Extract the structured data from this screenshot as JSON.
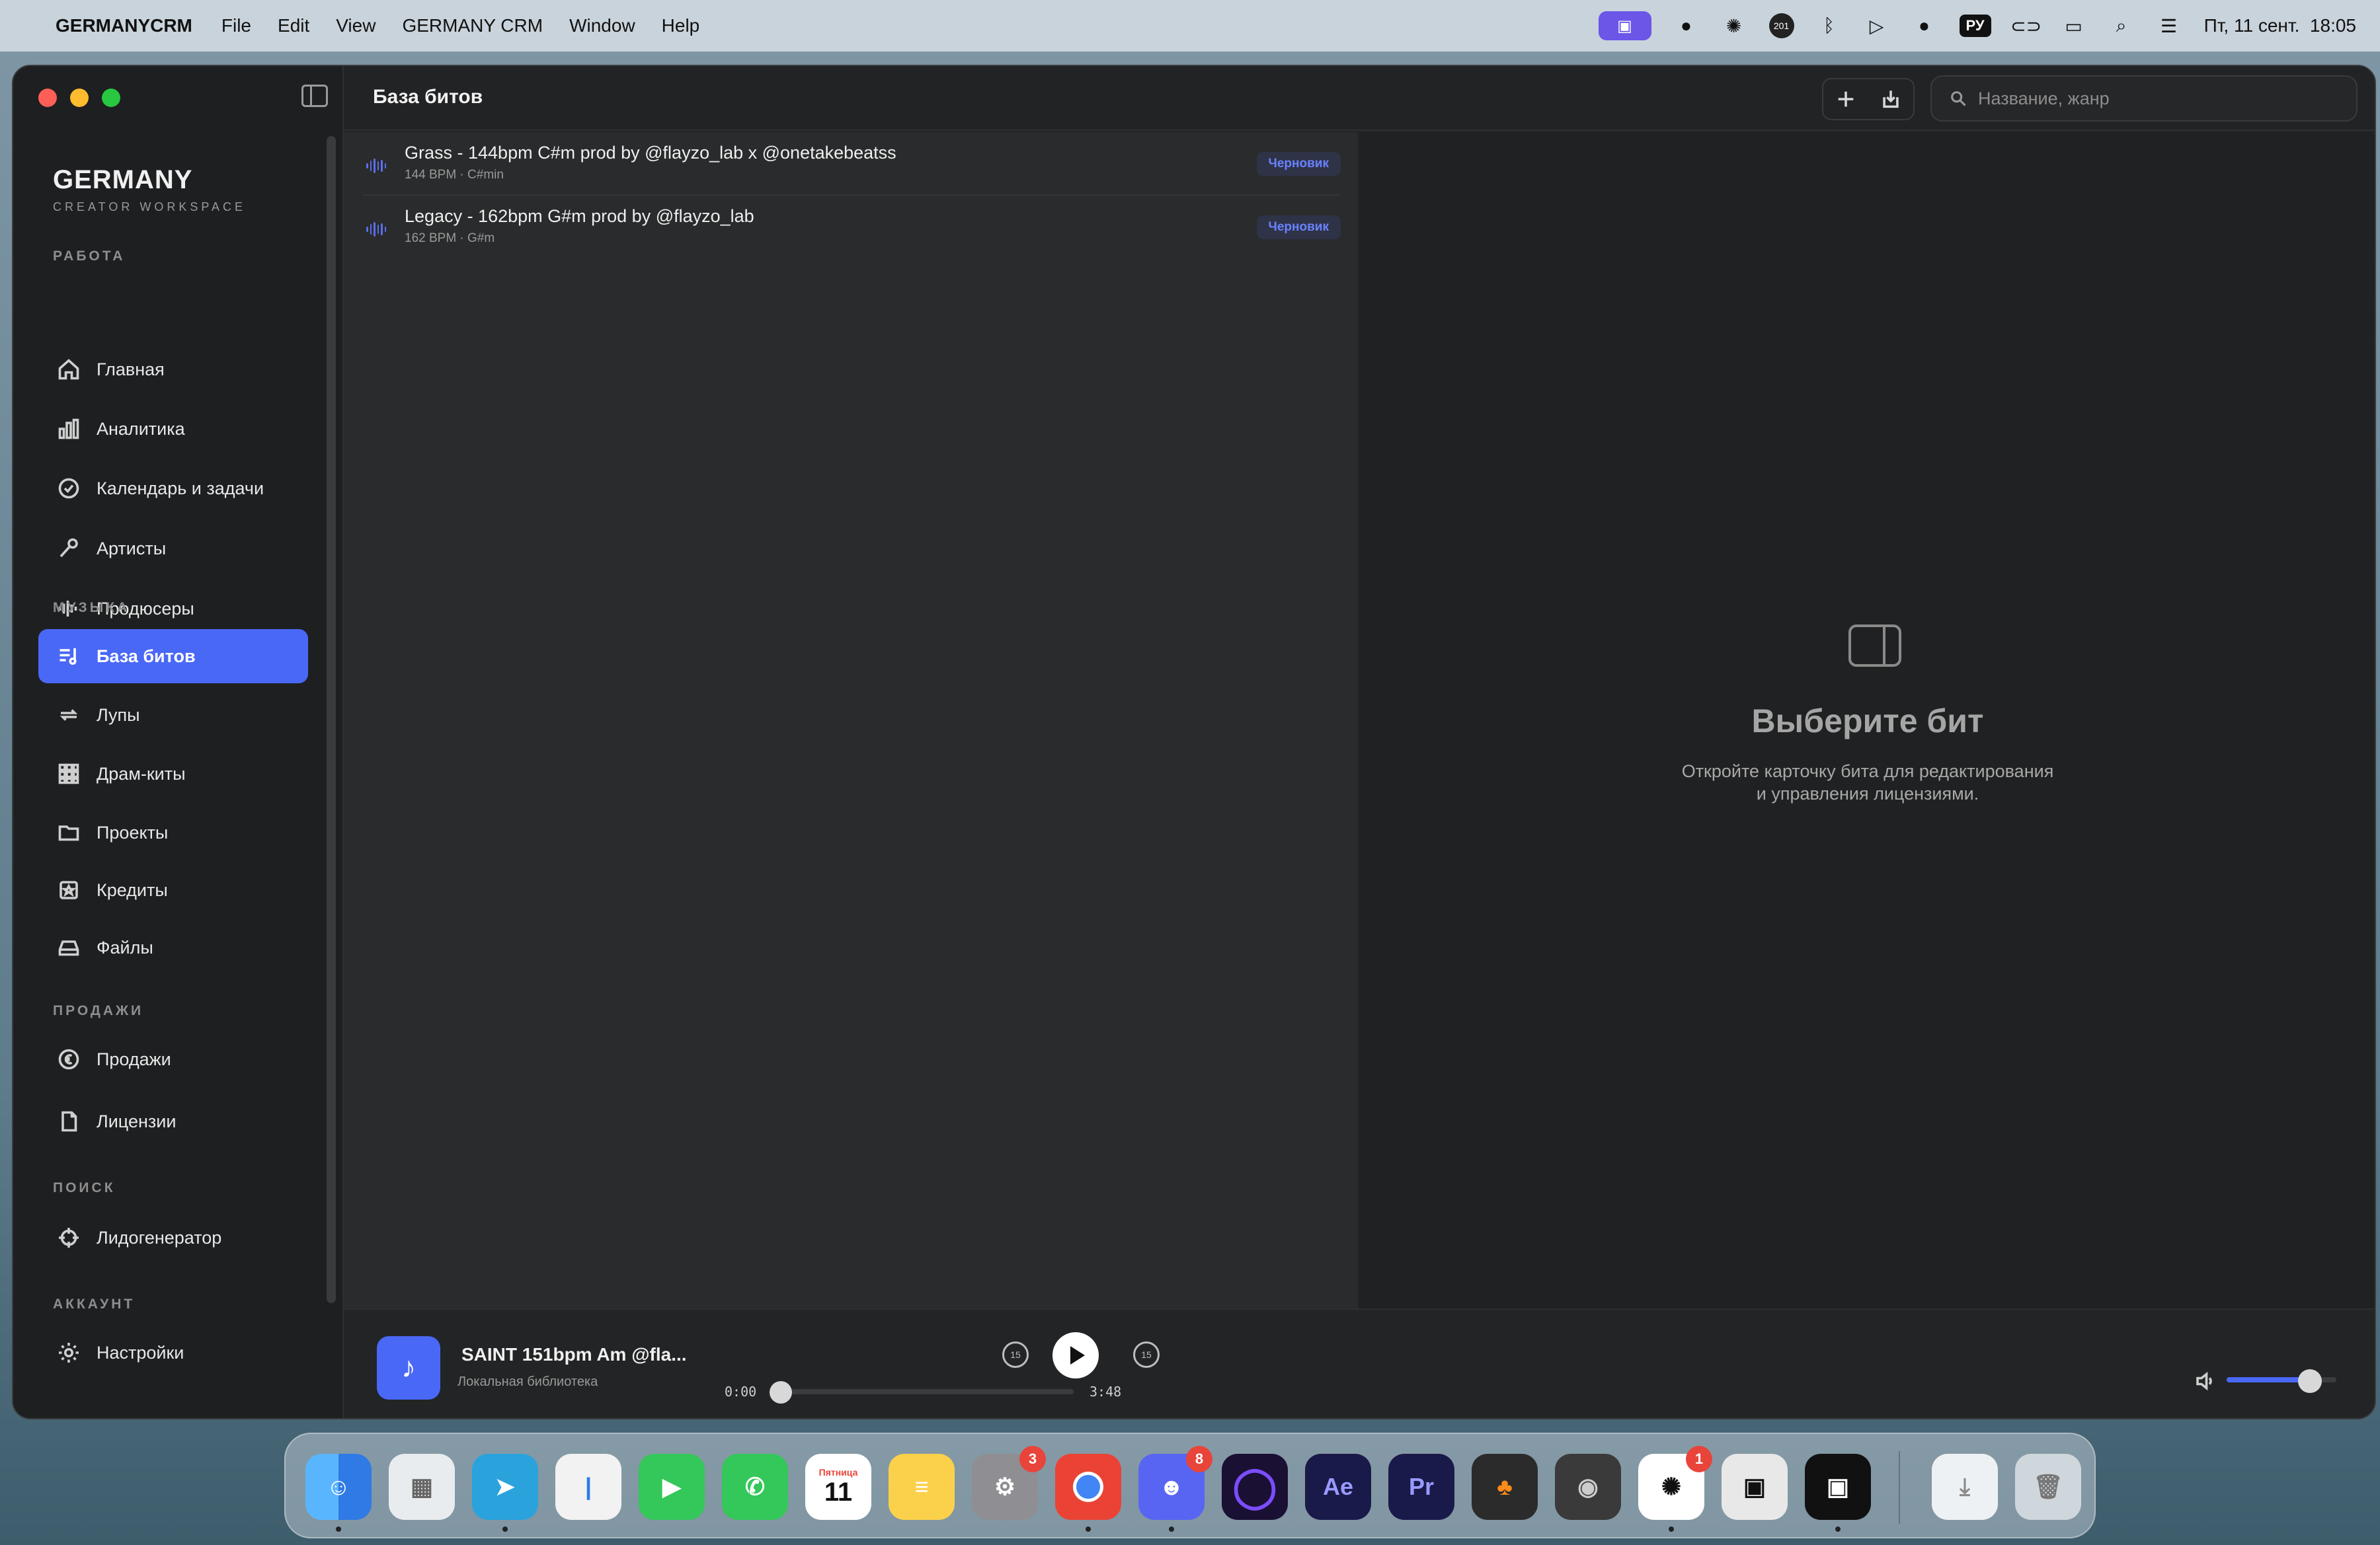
{
  "menubar": {
    "app_name": "GERMANYCRM",
    "menus": [
      "File",
      "Edit",
      "View",
      "GERMANY CRM",
      "Window",
      "Help"
    ],
    "lang": "РУ",
    "datetime": "Пт, 11 сент.  18:05",
    "badge_201": "201"
  },
  "window": {
    "brand": {
      "name": "GERMANY",
      "sub": "CREATOR WORKSPACE"
    },
    "sections": {
      "work": "РАБОТА",
      "music": "МУЗЫКА",
      "sales": "ПРОДАЖИ",
      "search": "ПОИСК",
      "account": "АККАУНТ"
    },
    "nav": {
      "home": "Главная",
      "analytics": "Аналитика",
      "calendar": "Календарь и задачи",
      "artists": "Артисты",
      "producers": "Продюсеры",
      "beats": "База битов",
      "loops": "Лупы",
      "drumkits": "Драм-киты",
      "projects": "Проекты",
      "credits": "Кредиты",
      "files": "Файлы",
      "sales": "Продажи",
      "licenses": "Лицензии",
      "leadgen": "Лидогенератор",
      "settings": "Настройки"
    },
    "active_nav": "beats"
  },
  "toolbar": {
    "title": "База битов",
    "search_placeholder": "Название, жанр"
  },
  "beats": [
    {
      "title": "Grass - 144bpm C#m prod by @flayzo_lab x @onetakebeatss",
      "meta": "144 BPM · C#min",
      "status": "Черновик"
    },
    {
      "title": "Legacy - 162bpm G#m prod by @flayzo_lab",
      "meta": "162 BPM · G#m",
      "status": "Черновик"
    }
  ],
  "detail": {
    "empty_title": "Выберите бит",
    "empty_text_1": "Откройте карточку бита для редактирования",
    "empty_text_2": "и управления лицензиями."
  },
  "player": {
    "track_title": "SAINT 151bpm Am @fla...",
    "source": "Локальная библиотека",
    "time_current": "0:00",
    "time_total": "3:48",
    "skip_back_label": "15",
    "skip_fwd_label": "15",
    "progress": 0.0,
    "volume": 0.76
  },
  "dock": {
    "calendar_month": "Пятница",
    "calendar_day": "11",
    "settings_badge": "3",
    "discord_badge": "8",
    "chatgpt_badge": "1"
  },
  "colors": {
    "accent": "#4a68f6",
    "badge_text": "#6a82ff"
  }
}
